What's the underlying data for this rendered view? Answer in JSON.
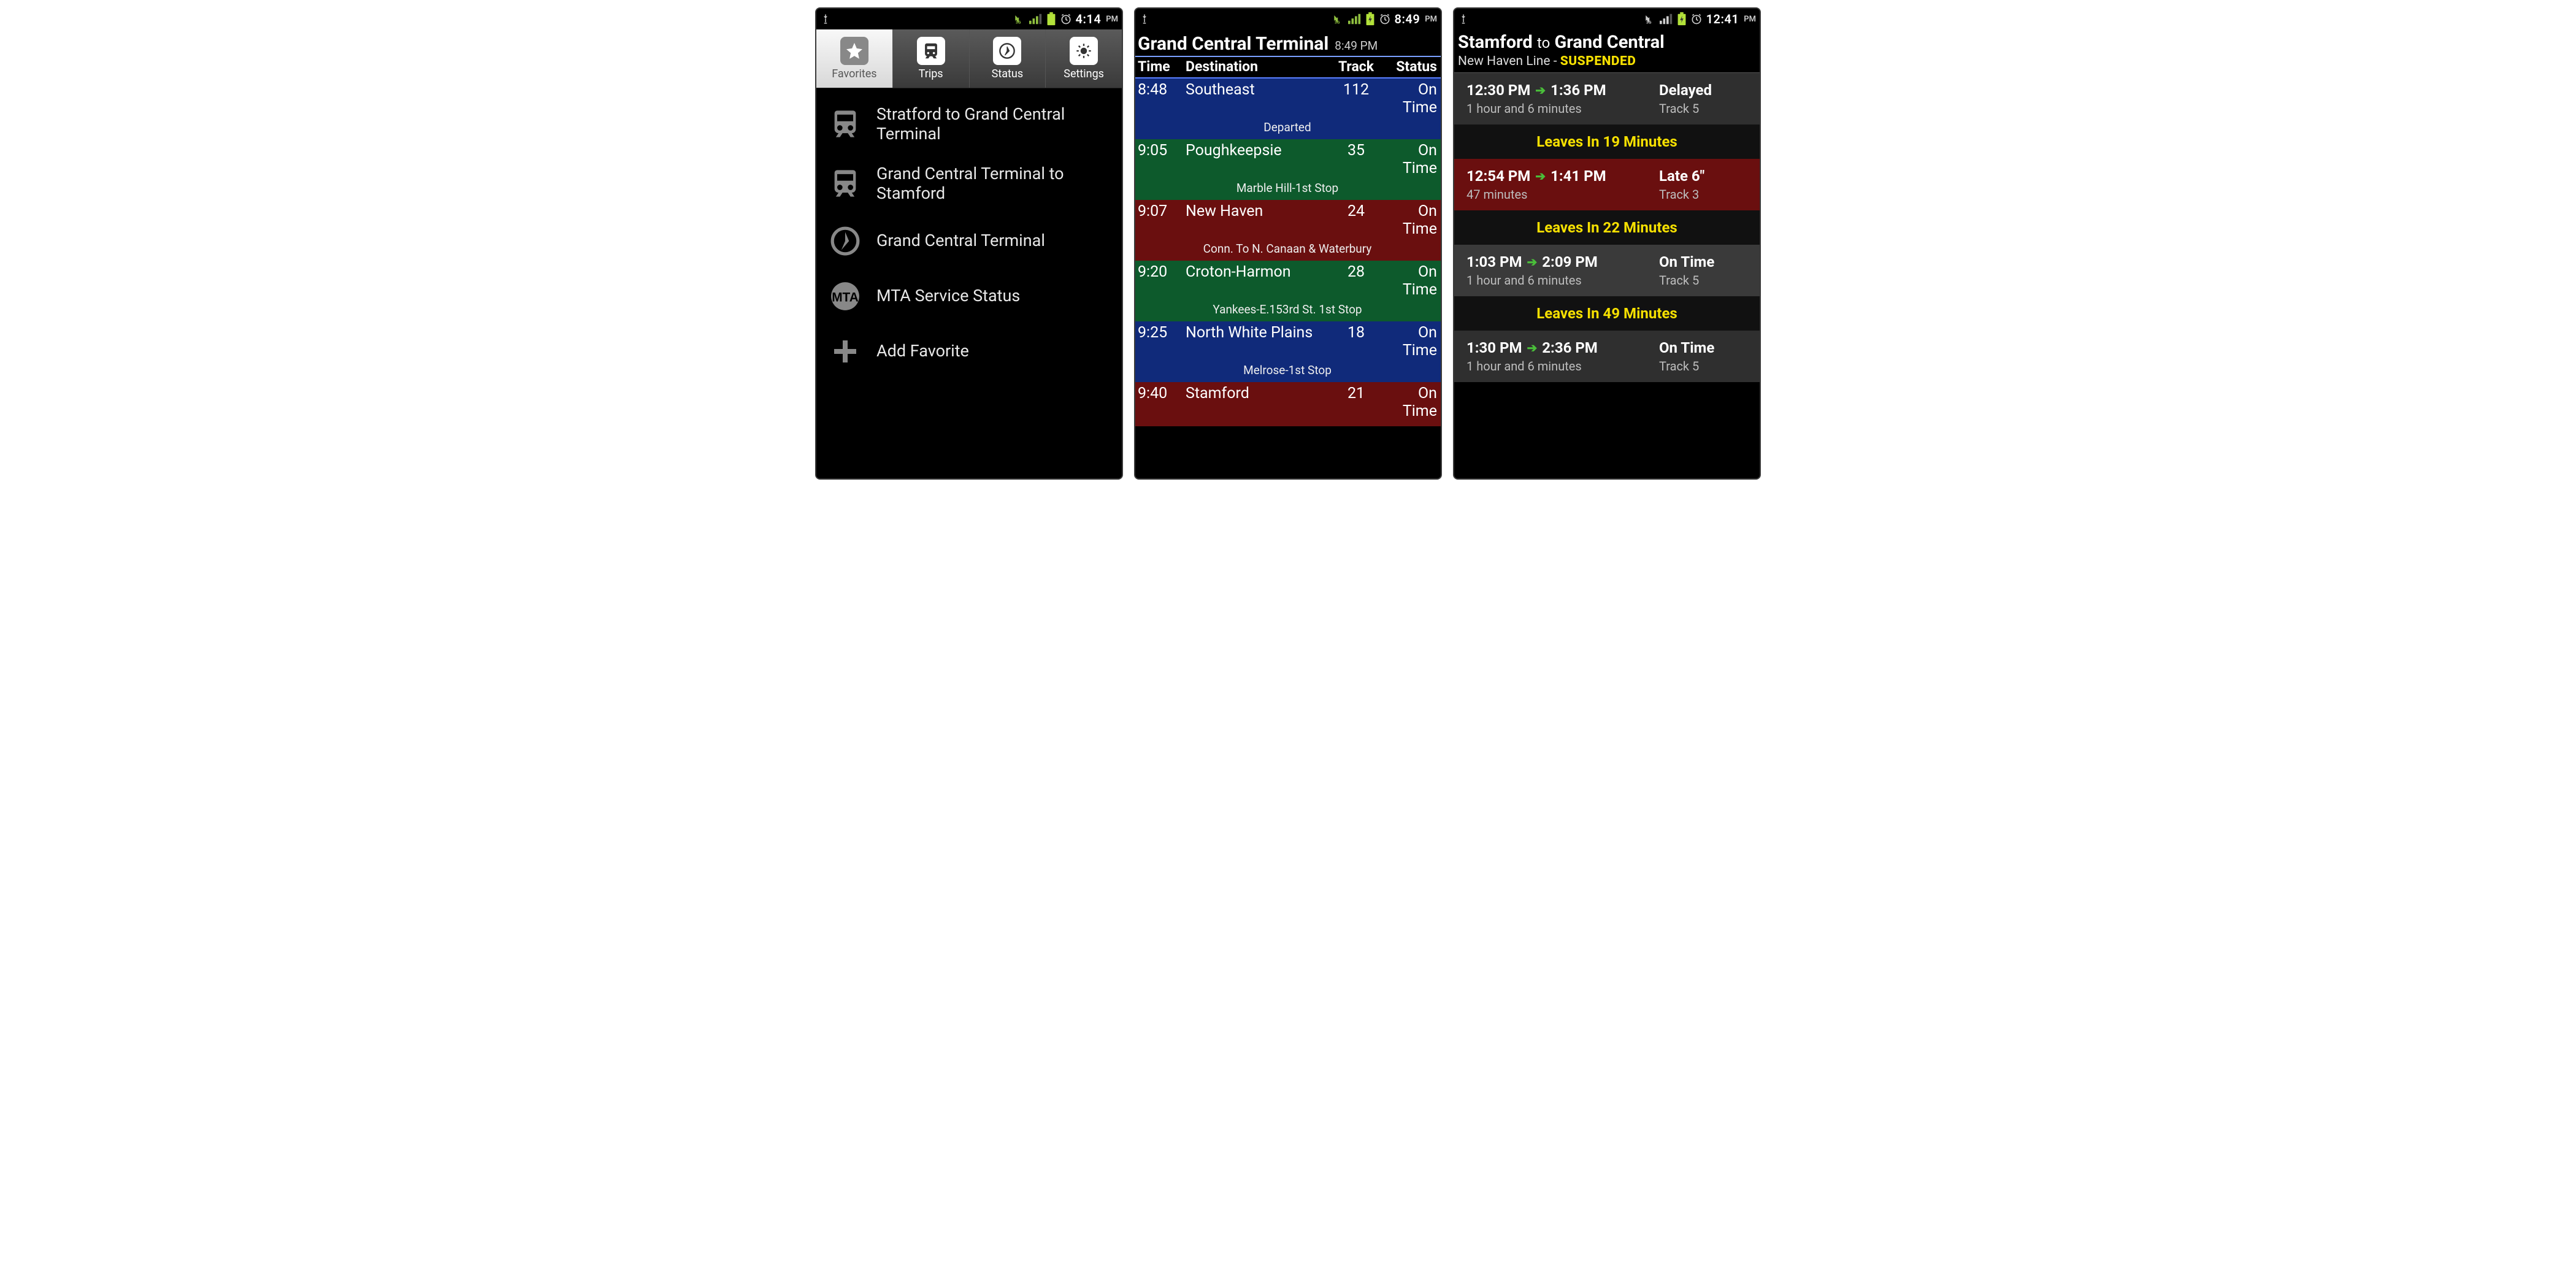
{
  "screen1": {
    "statusbar": {
      "time": "4:14",
      "ampm": "PM"
    },
    "tabs": [
      {
        "label": "Favorites",
        "active": true
      },
      {
        "label": "Trips"
      },
      {
        "label": "Status"
      },
      {
        "label": "Settings"
      }
    ],
    "favorites": [
      {
        "icon": "train",
        "label": "Stratford to Grand Central Terminal"
      },
      {
        "icon": "train",
        "label": "Grand Central Terminal to Stamford"
      },
      {
        "icon": "compass",
        "label": "Grand Central Terminal"
      },
      {
        "icon": "mta",
        "label": "MTA Service Status"
      },
      {
        "icon": "plus",
        "label": "Add Favorite"
      }
    ]
  },
  "screen2": {
    "statusbar": {
      "time": "8:49",
      "ampm": "PM"
    },
    "station": "Grand Central Terminal",
    "asof": "8:49 PM",
    "columns": [
      "Time",
      "Destination",
      "Track",
      "Status"
    ],
    "departures": [
      {
        "time": "8:48",
        "dest": "Southeast",
        "track": "112",
        "status": "On Time",
        "note": "Departed",
        "line": "blue"
      },
      {
        "time": "9:05",
        "dest": "Poughkeepsie",
        "track": "35",
        "status": "On Time",
        "note": "Marble Hill-1st Stop",
        "line": "green"
      },
      {
        "time": "9:07",
        "dest": "New Haven",
        "track": "24",
        "status": "On Time",
        "note": "Conn. To N. Canaan & Waterbury",
        "line": "red"
      },
      {
        "time": "9:20",
        "dest": "Croton-Harmon",
        "track": "28",
        "status": "On Time",
        "note": "Yankees-E.153rd St. 1st Stop",
        "line": "green"
      },
      {
        "time": "9:25",
        "dest": "North White Plains",
        "track": "18",
        "status": "On Time",
        "note": "Melrose-1st Stop",
        "line": "blue"
      },
      {
        "time": "9:40",
        "dest": "Stamford",
        "track": "21",
        "status": "On Time",
        "note": "",
        "line": "red"
      }
    ]
  },
  "screen3": {
    "statusbar": {
      "time": "12:41",
      "ampm": "PM"
    },
    "route_from": "Stamford",
    "route_to_word": "to",
    "route_to": "Grand Central",
    "line_name": "New Haven Line",
    "line_sep": "  -  ",
    "line_status": "SUSPENDED",
    "trips": [
      {
        "leave": "12:30 PM",
        "arrive": "1:36 PM",
        "status": "Delayed",
        "duration": "1 hour and 6 minutes",
        "track": "Track 5",
        "bg": "dark1",
        "banner_after": "Leaves In 19 Minutes"
      },
      {
        "leave": "12:54 PM",
        "arrive": "1:41 PM",
        "status": "Late 6\"",
        "duration": "47 minutes",
        "track": "Track 3",
        "bg": "blood",
        "banner_after": "Leaves In 22 Minutes"
      },
      {
        "leave": "1:03 PM",
        "arrive": "2:09 PM",
        "status": "On Time",
        "duration": "1 hour and 6 minutes",
        "track": "Track 5",
        "bg": "dark2",
        "banner_after": "Leaves In 49 Minutes"
      },
      {
        "leave": "1:30 PM",
        "arrive": "2:36 PM",
        "status": "On Time",
        "duration": "1 hour and 6 minutes",
        "track": "Track 5",
        "bg": "dark1"
      }
    ]
  }
}
